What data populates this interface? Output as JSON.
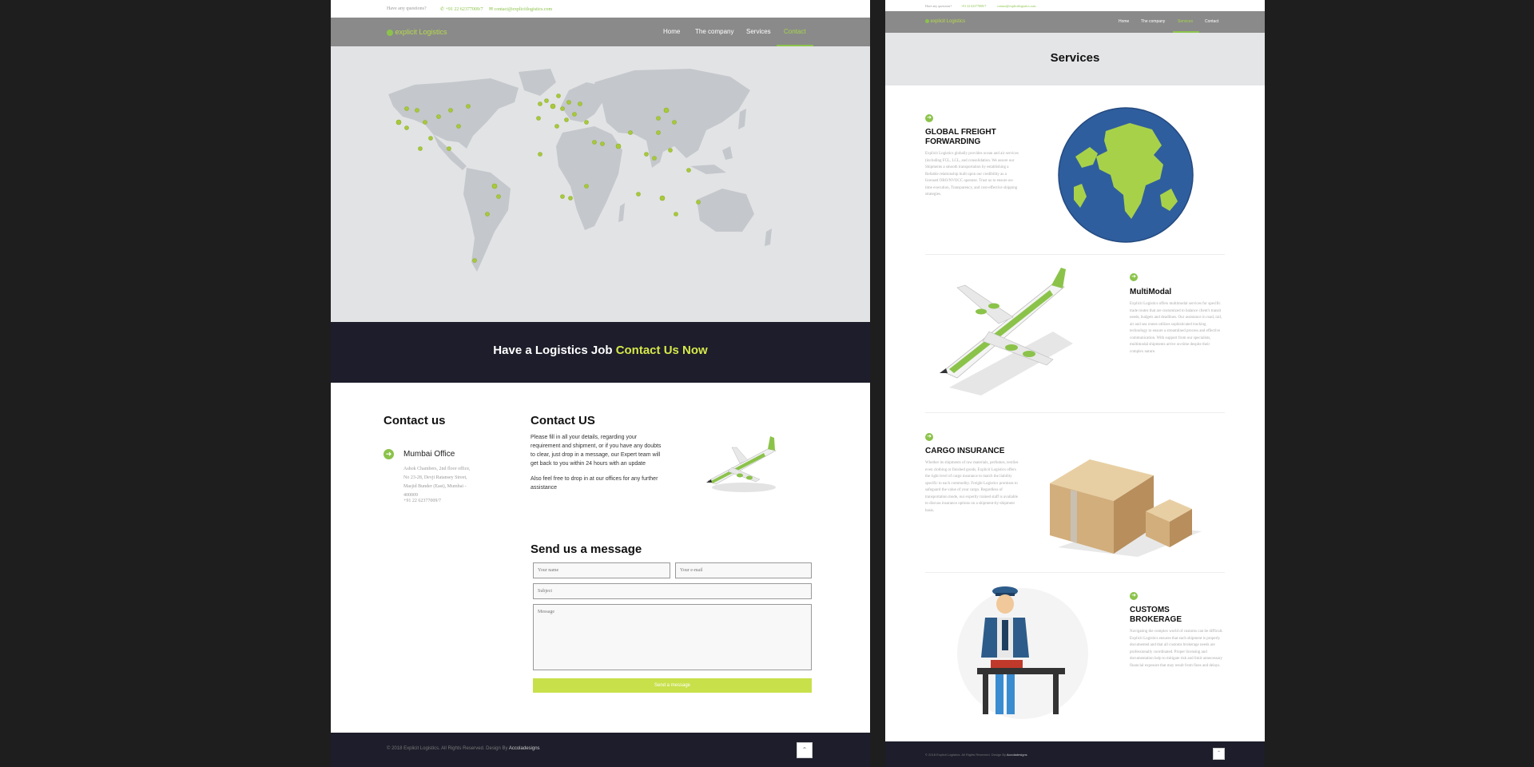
{
  "contact_page": {
    "topbar": {
      "question": "Have any questions?",
      "phone": "+91 22 62377009/7",
      "email": "contact@explicitlogistics.com"
    },
    "logo": "explicit Logistics",
    "nav": [
      {
        "label": "Home"
      },
      {
        "label": "The company"
      },
      {
        "label": "Services"
      },
      {
        "label": "Contact",
        "active": true
      }
    ],
    "cta": {
      "prefix": "Have a Logistics Job",
      "highlight": "Contact Us Now"
    },
    "contact_us": {
      "title": "Contact us",
      "office_name": "Mumbai Office",
      "address": "Ashok Chambers, 2nd floor office, No 23-28, Devji Ratansey Street, Masjid Bunder (East), Mumbai - 400009",
      "phone": "+91 22 62377009/7"
    },
    "contact_form_intro": {
      "title": "Contact US",
      "paragraph1": "Please fill in all your details, regarding your requirement and shipment, or if you have any doubts to clear, just drop in a message, our Expert team will get back to you within 24 hours with an update",
      "paragraph2": "Also feel free to drop in at our offices for any further assistance"
    },
    "message_form": {
      "title": "Send us a message",
      "name_placeholder": "Your name",
      "email_placeholder": "Your e-mail",
      "subject_placeholder": "Subject",
      "message_placeholder": "Message",
      "submit_label": "Send a message"
    },
    "footer": {
      "copyright": "© 2018 Explicit Logistics. All Rights Reserved. Design By",
      "designer": "Accoladesigns",
      "scroll_top_icon": "chevron-up-icon"
    }
  },
  "services_page": {
    "topbar": {
      "question": "Have any questions?",
      "phone": "+91 22 62377009/7",
      "email": "contact@explicitlogistics.com"
    },
    "logo": "explicit Logistics",
    "nav": [
      {
        "label": "Home"
      },
      {
        "label": "The company"
      },
      {
        "label": "Services",
        "active": true
      },
      {
        "label": "Contact"
      }
    ],
    "title": "Services",
    "services": [
      {
        "title": "GLOBAL FREIGHT FORWARDING",
        "text": "Explicit Logistics globally provides ocean and air services (including FCL, LCL, and consolidation. We assure our Shipments a smooth transportation by establishing a Reliable relationship built upon our credibility as a licensed OBO/NVOCC operator. Trust us to ensure on-time execution, Transparency, and cost-effective shipping strategies."
      },
      {
        "title": "MultiModal",
        "text": "Explicit Logistics offers multimodal services for specific trade routes that are customized to balance client's transit needs, budgets and deadlines. Our assistance in road, rail, air and sea routes utilizes sophisticated tracking technology to ensure a streamlined process and effective communication. With support from our specialists, multimodal shipments arrive on-time despite their complex nature."
      },
      {
        "title": "CARGO INSURANCE",
        "text": "Whether its shipments of raw materials, perfumes, textiles even clothing or finished goods, Explicit Logistics offers the right level of cargo insurance to match the liability specific to each commodity. Freight Logistics promises to safeguard the value of your cargo. Regardless of transportation mode, our expertly trained staff is available to discuss insurance options on a shipment-by-shipment basis."
      },
      {
        "title": "CUSTOMS BROKERAGE",
        "text": "Navigating the complex world of customs can be difficult. Explicit Logistics ensures that each shipment is properly documented and that all customs brokerage needs are professionally coordinated. Proper licensing and documentation help to mitigate risk and limit unnecessary financial exposure that may result from fines and delays."
      }
    ],
    "footer": {
      "copyright": "© 2018 Explicit Logistics. All Rights Reserved. Design By",
      "designer": "Accoladesigns"
    }
  },
  "colors": {
    "brand_green": "#8bc34a",
    "cta_highlight": "#d6e84a",
    "dark_band": "#1d1d2b",
    "nav_grey": "#8a8a8a",
    "map_bg": "#e2e3e5",
    "globe_ocean": "#2f5e9e"
  }
}
